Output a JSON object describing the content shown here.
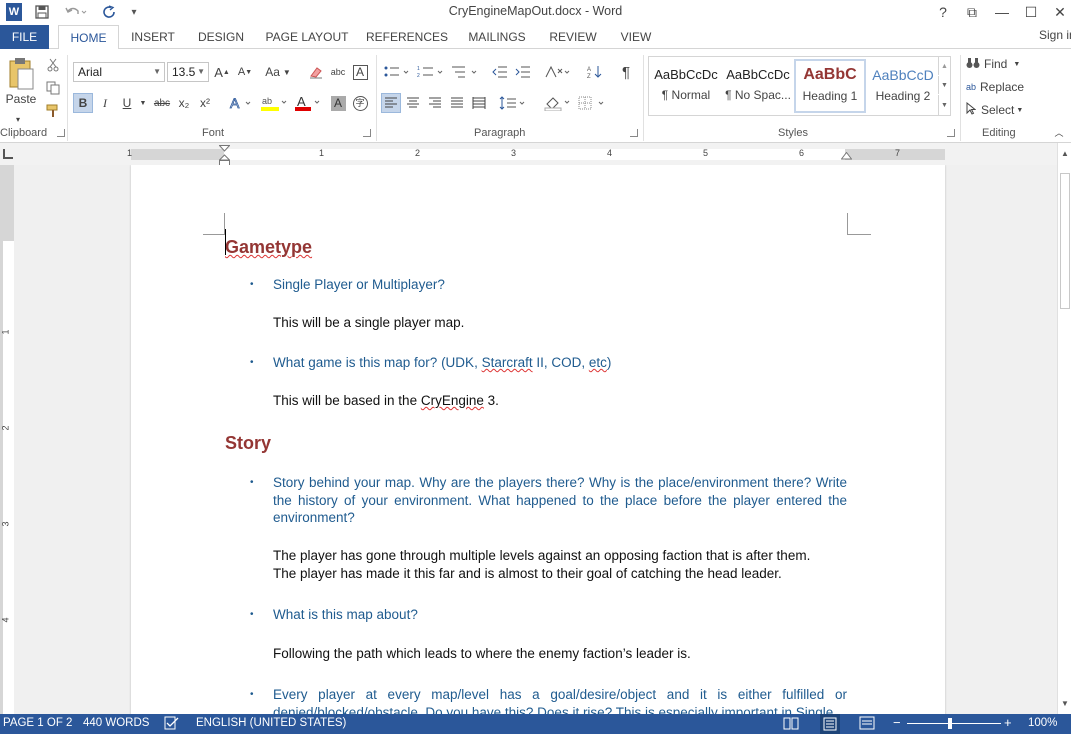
{
  "window": {
    "title": "CryEngineMapOut.docx - Word",
    "help": "?",
    "restore_ribbon": "⧉",
    "minimize": "—",
    "maximize": "☐",
    "close": "✕"
  },
  "quick_access": {
    "word_icon": "W",
    "save_icon": "save-icon",
    "undo_icon": "undo-icon",
    "redo_icon": "redo-icon",
    "customize_icon": "customize-icon"
  },
  "tabs": {
    "file": "FILE",
    "items": [
      "HOME",
      "INSERT",
      "DESIGN",
      "PAGE LAYOUT",
      "REFERENCES",
      "MAILINGS",
      "REVIEW",
      "VIEW"
    ],
    "signin": "Sign in"
  },
  "ribbon": {
    "clipboard": {
      "paste": "Paste",
      "label": "Clipboard"
    },
    "font": {
      "family": "Arial",
      "size": "13.5",
      "grow": "A",
      "shrink": "A",
      "change_case": "Aa",
      "bold": "B",
      "italic": "I",
      "underline": "U",
      "strike": "abc",
      "subscript": "x₂",
      "superscript": "x²",
      "label": "Font"
    },
    "paragraph": {
      "pilcrow": "¶",
      "label": "Paragraph"
    },
    "styles": {
      "items": [
        {
          "preview": "AaBbCcDc",
          "name": "¶ Normal"
        },
        {
          "preview": "AaBbCcDc",
          "name": "¶ No Spac..."
        },
        {
          "preview": "AaBbC",
          "name": "Heading 1"
        },
        {
          "preview": "AaBbCcD",
          "name": "Heading 2"
        }
      ],
      "label": "Styles"
    },
    "editing": {
      "find": "Find",
      "replace": "Replace",
      "select": "Select",
      "label": "Editing"
    }
  },
  "ruler": {
    "numbers": [
      "1",
      "1",
      "2",
      "3",
      "4",
      "5",
      "6",
      "7"
    ],
    "vertical_numbers": [
      "1",
      "2",
      "3",
      "4"
    ]
  },
  "document": {
    "heading_gametype": "Gametype",
    "q1": "Single Player or Multiplayer?",
    "a1": "This will be a single player map.",
    "q2_pre": "What game is this map for? (UDK, ",
    "q2_starcraft": "Starcraft",
    "q2_mid": " II, COD, ",
    "q2_etc": "etc",
    "q2_end": ")",
    "a2_pre": "This will be based in the ",
    "a2_cryengine": "CryEngine",
    "a2_end": " 3.",
    "heading_story": "Story",
    "q3": "Story behind your map. Why are the players there? Why is the place/environment there? Write the history of your environment. What happened to the place before the player entered the environment?",
    "a3_line1": "The player has gone through multiple levels against an opposing faction that is after them.",
    "a3_line2": "The player has made it this far and is almost to their goal of catching the head leader.",
    "q4": "What is this map about?",
    "a4": "Following the path which leads to where the enemy faction’s leader is.",
    "q5": "Every player at every map/level has a goal/desire/object and it is either fulfilled or denied/blocked/obstacle. Do you have this? Does it rise? This is especially important in Single"
  },
  "status": {
    "page": "PAGE 1 OF 2",
    "words": "440 WORDS",
    "language": "ENGLISH (UNITED STATES)",
    "zoom": "100%"
  },
  "colors": {
    "accent": "#2b579a",
    "heading": "#943634",
    "question": "#1f5b8f"
  }
}
